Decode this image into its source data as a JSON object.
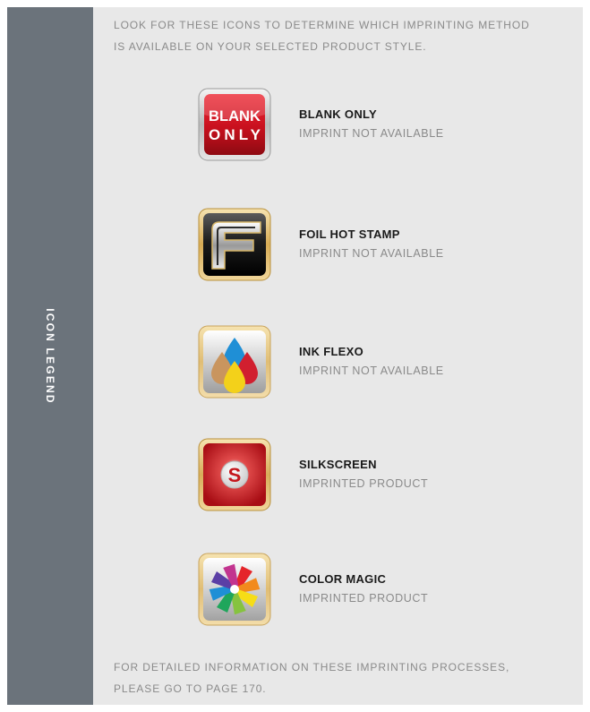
{
  "sidebar": {
    "label": "ICON LEGEND"
  },
  "intro": {
    "line1": "LOOK FOR THESE ICONS TO DETERMINE WHICH IMPRINTING METHOD",
    "line2": "IS AVAILABLE ON YOUR SELECTED PRODUCT STYLE."
  },
  "items": [
    {
      "title": "BLANK ONLY",
      "subtitle": "IMPRINT NOT AVAILABLE",
      "icon": "blank-only-icon",
      "icon_text_1": "BLANK",
      "icon_text_2": "ONLY"
    },
    {
      "title": "FOIL HOT STAMP",
      "subtitle": "IMPRINT NOT AVAILABLE",
      "icon": "foil-hot-stamp-icon"
    },
    {
      "title": "INK FLEXO",
      "subtitle": "IMPRINT NOT AVAILABLE",
      "icon": "ink-flexo-icon"
    },
    {
      "title": "SILKSCREEN",
      "subtitle": "IMPRINTED PRODUCT",
      "icon": "silkscreen-icon",
      "icon_text": "S"
    },
    {
      "title": "COLOR MAGIC",
      "subtitle": "IMPRINTED PRODUCT",
      "icon": "color-magic-icon"
    }
  ],
  "footer": {
    "line1": "FOR DETAILED INFORMATION ON THESE IMPRINTING PROCESSES,",
    "line2": "PLEASE GO TO PAGE 170."
  },
  "colors": {
    "sidebar": "#6b737b",
    "panel": "#e8e8e8",
    "blank_only_red": "#c8101e",
    "silkscreen_red": "#c4161c",
    "gold_frame": "#e2c07a"
  }
}
